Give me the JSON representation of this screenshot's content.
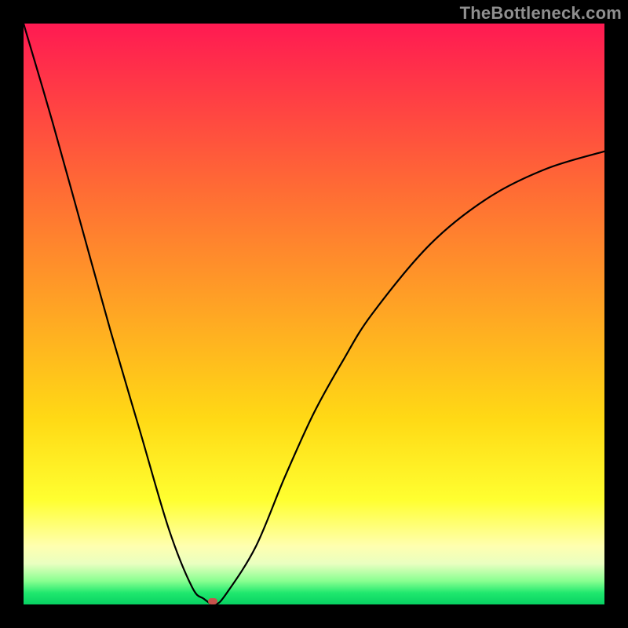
{
  "watermark": "TheBottleneck.com",
  "chart_data": {
    "type": "line",
    "title": "",
    "xlabel": "",
    "ylabel": "",
    "xlim": [
      0,
      100
    ],
    "ylim": [
      0,
      100
    ],
    "grid": false,
    "series": [
      {
        "name": "bottleneck-curve",
        "x": [
          0,
          5,
          10,
          15,
          20,
          25,
          29,
          31,
          33,
          35,
          40,
          45,
          50,
          55,
          60,
          70,
          80,
          90,
          100
        ],
        "values": [
          100,
          83,
          65,
          47,
          30,
          13,
          3,
          1,
          0,
          2,
          10,
          22,
          33,
          42,
          50,
          62,
          70,
          75,
          78
        ]
      }
    ],
    "annotations": [
      {
        "name": "optimal-marker",
        "x": 32.5,
        "y": 0.5,
        "color": "#c9524c"
      }
    ],
    "background_gradient": {
      "top": "#ff1a52",
      "mid": "#ffd915",
      "bottom": "#07d162"
    }
  }
}
